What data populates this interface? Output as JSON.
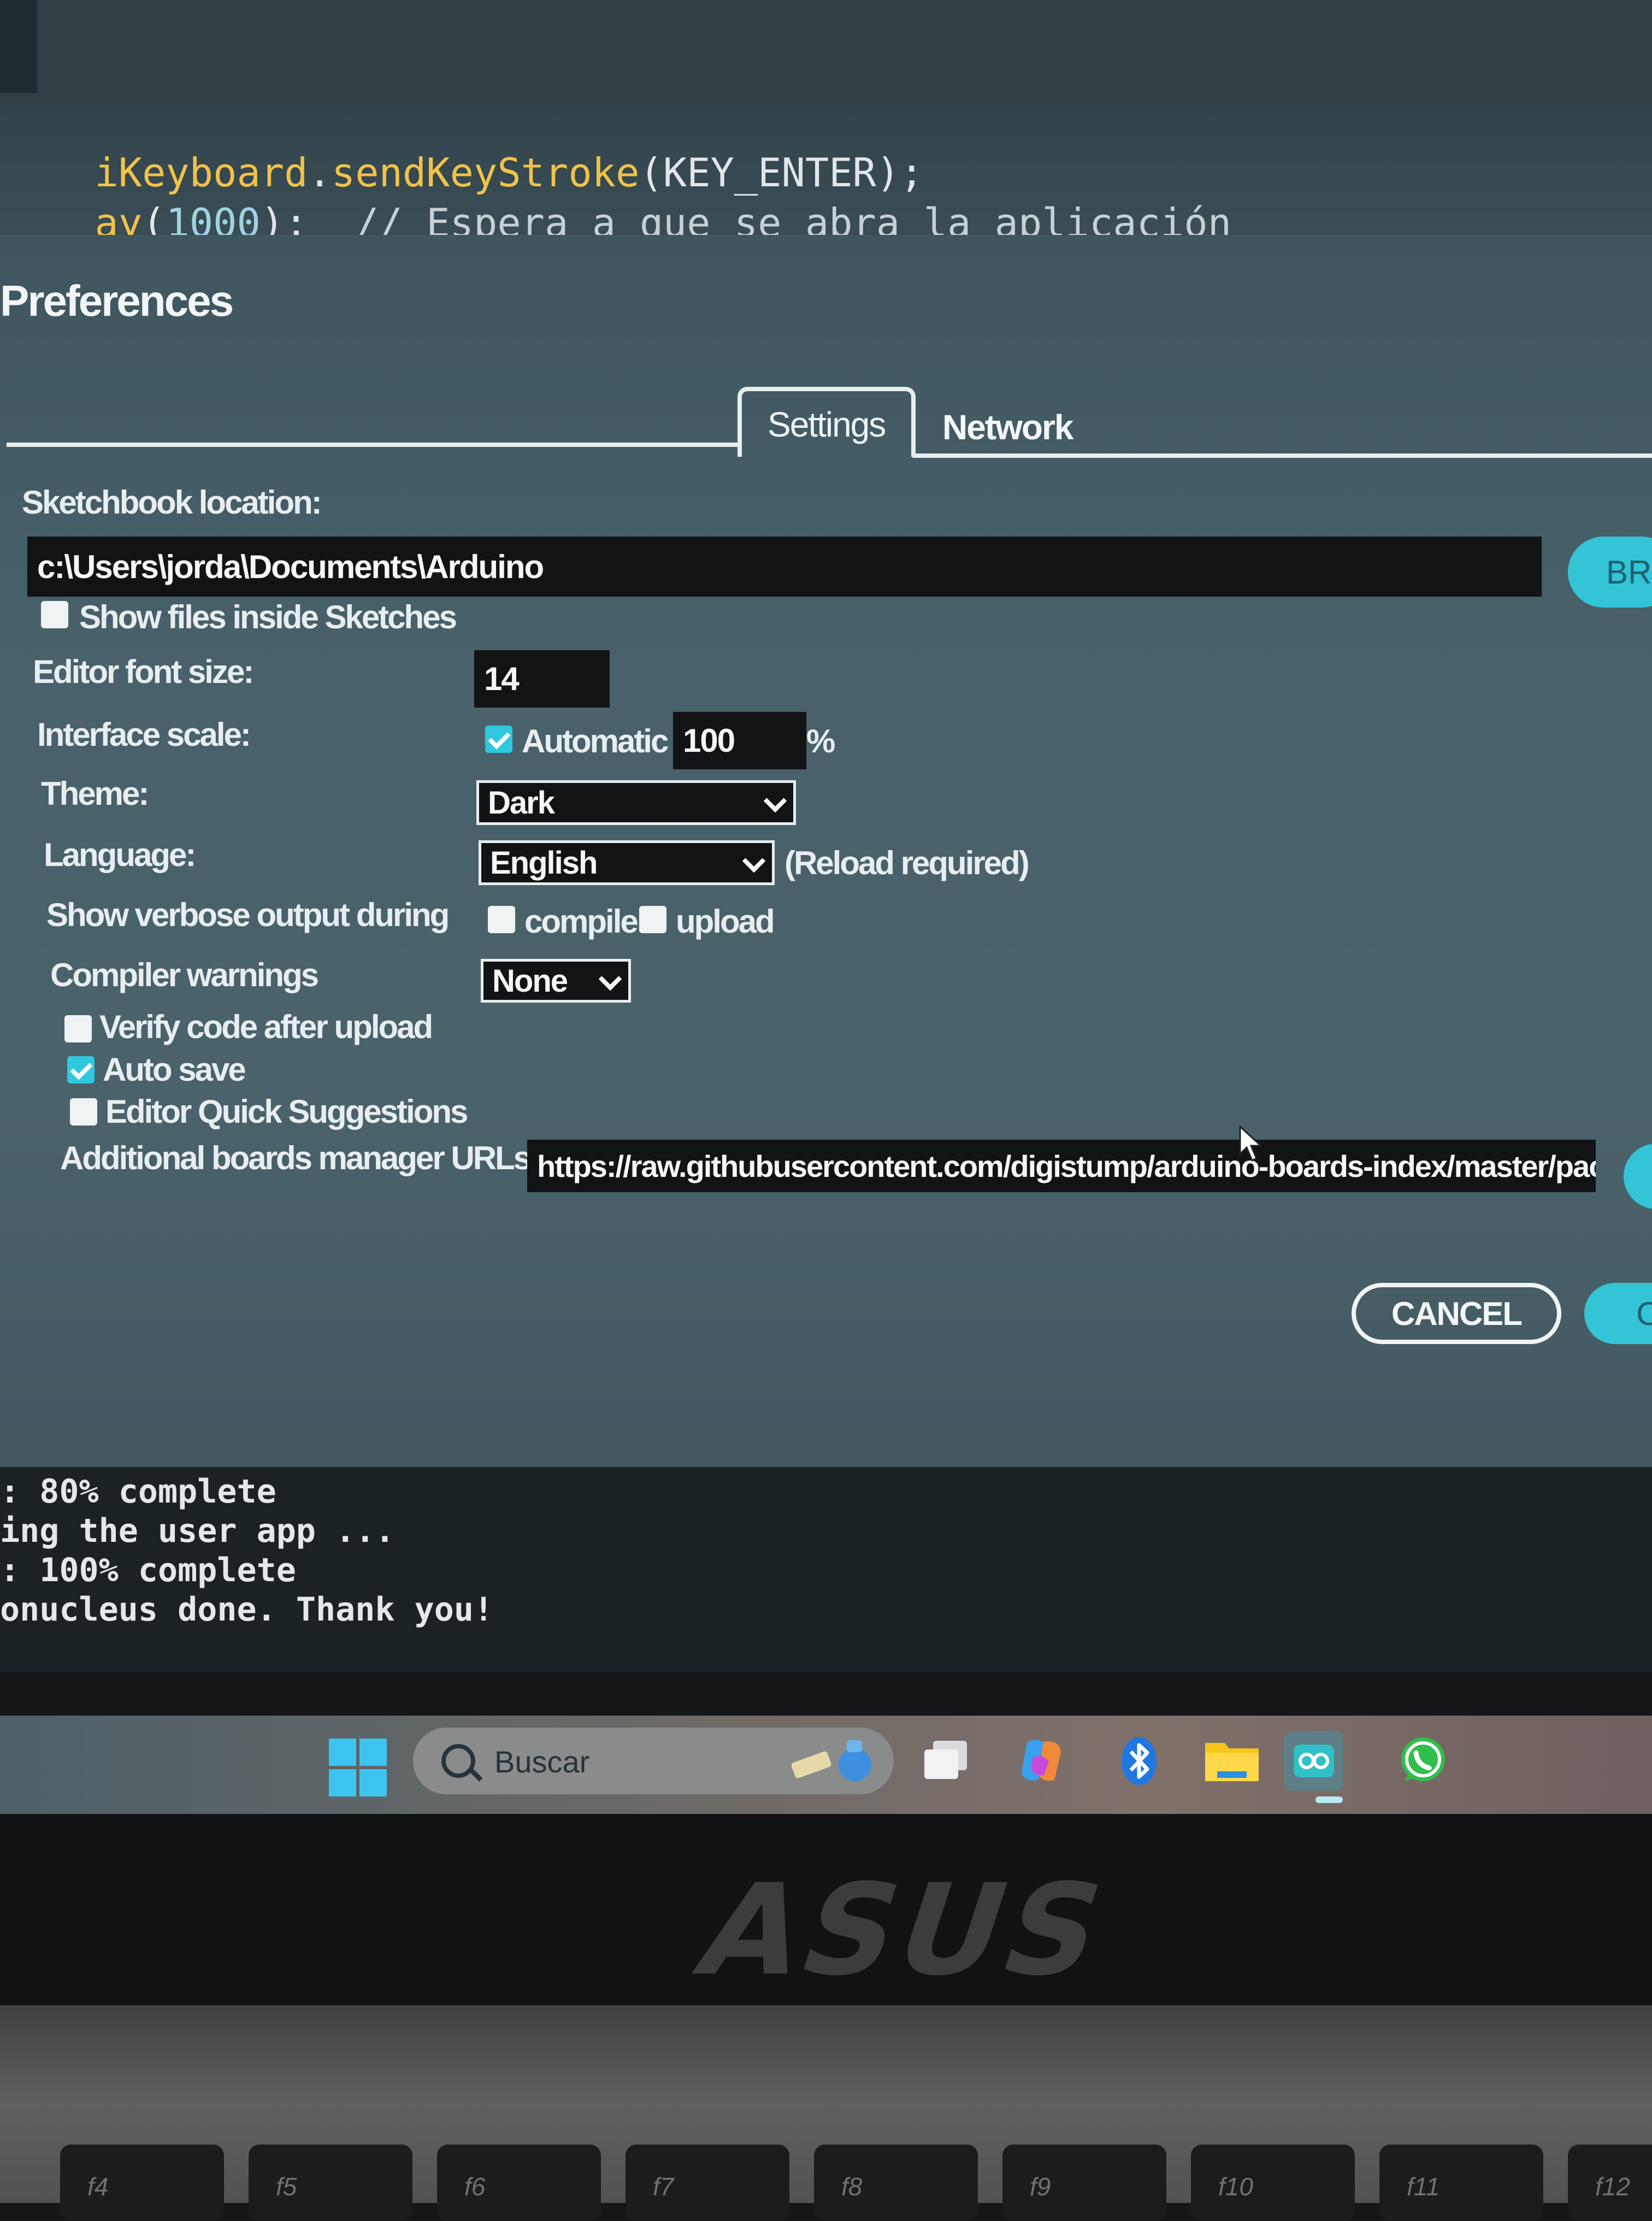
{
  "code": {
    "line1": {
      "object": "iKeyboard",
      "dot": ".",
      "method": "sendKeyStroke",
      "args": "(KEY_ENTER);"
    },
    "line2": {
      "fn": "ay",
      "open": "(",
      "number": "1000",
      "close": ");",
      "comment": "// Espera a que se abra la aplicación"
    }
  },
  "preferences": {
    "title": "Preferences",
    "tabs": [
      "Settings",
      "Network"
    ],
    "sketchbook_label": "Sketchbook location:",
    "sketchbook_path": "c:\\Users\\jorda\\Documents\\Arduino",
    "browse_label": "BR",
    "show_files_label": "Show files inside Sketches",
    "show_files_checked": false,
    "font_size_label": "Editor font size:",
    "font_size_value": "14",
    "scale_label": "Interface scale:",
    "scale_automatic_label": "Automatic",
    "scale_automatic_checked": true,
    "scale_value": "100",
    "scale_unit": "%",
    "theme_label": "Theme:",
    "theme_value": "Dark",
    "language_label": "Language:",
    "language_value": "English",
    "language_note": "(Reload required)",
    "verbose_label": "Show verbose output during",
    "verbose_compile_label": "compile",
    "verbose_compile_checked": false,
    "verbose_upload_label": "upload",
    "verbose_upload_checked": false,
    "compiler_warnings_label": "Compiler warnings",
    "compiler_warnings_value": "None",
    "verify_label": "Verify code after upload",
    "verify_checked": false,
    "autosave_label": "Auto save",
    "autosave_checked": true,
    "quick_suggestions_label": "Editor Quick Suggestions",
    "quick_suggestions_checked": false,
    "urls_label": "Additional boards manager URLs:",
    "urls_value": "https://raw.githubusercontent.com/digistump/arduino-boards-index/master/pac...",
    "cancel_label": "CANCEL",
    "ok_label": "C"
  },
  "console": {
    "lines": [
      ": 80% complete",
      "ing the user app ...",
      ": 100% complete",
      "onucleus done. Thank you!"
    ]
  },
  "taskbar": {
    "search_placeholder": "Buscar",
    "icons": [
      "windows-start-icon",
      "search-icon",
      "task-view-icon",
      "copilot-icon",
      "bluetooth-icon",
      "file-explorer-icon",
      "arduino-ide-icon",
      "whatsapp-icon"
    ]
  },
  "laptop": {
    "brand": "ASUS",
    "fkeys": [
      "f4",
      "f5",
      "f6",
      "f7",
      "f8",
      "f9",
      "f10",
      "f11",
      "f12"
    ]
  },
  "colors": {
    "accent": "#33c4d6",
    "dialog_bg": "#48616a",
    "field_bg": "#111314"
  }
}
